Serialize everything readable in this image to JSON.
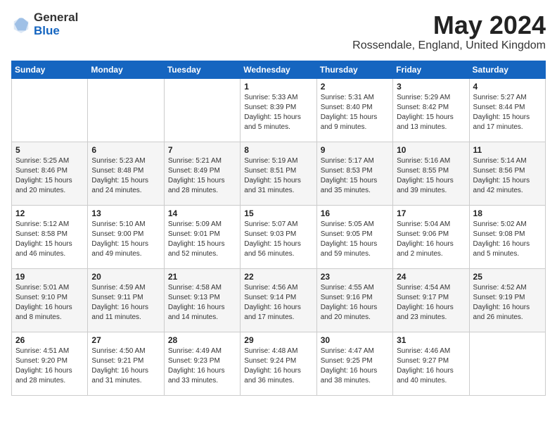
{
  "header": {
    "logo_general": "General",
    "logo_blue": "Blue",
    "month_year": "May 2024",
    "location": "Rossendale, England, United Kingdom"
  },
  "days_of_week": [
    "Sunday",
    "Monday",
    "Tuesday",
    "Wednesday",
    "Thursday",
    "Friday",
    "Saturday"
  ],
  "weeks": [
    [
      {
        "day": "",
        "info": ""
      },
      {
        "day": "",
        "info": ""
      },
      {
        "day": "",
        "info": ""
      },
      {
        "day": "1",
        "info": "Sunrise: 5:33 AM\nSunset: 8:39 PM\nDaylight: 15 hours\nand 5 minutes."
      },
      {
        "day": "2",
        "info": "Sunrise: 5:31 AM\nSunset: 8:40 PM\nDaylight: 15 hours\nand 9 minutes."
      },
      {
        "day": "3",
        "info": "Sunrise: 5:29 AM\nSunset: 8:42 PM\nDaylight: 15 hours\nand 13 minutes."
      },
      {
        "day": "4",
        "info": "Sunrise: 5:27 AM\nSunset: 8:44 PM\nDaylight: 15 hours\nand 17 minutes."
      }
    ],
    [
      {
        "day": "5",
        "info": "Sunrise: 5:25 AM\nSunset: 8:46 PM\nDaylight: 15 hours\nand 20 minutes."
      },
      {
        "day": "6",
        "info": "Sunrise: 5:23 AM\nSunset: 8:48 PM\nDaylight: 15 hours\nand 24 minutes."
      },
      {
        "day": "7",
        "info": "Sunrise: 5:21 AM\nSunset: 8:49 PM\nDaylight: 15 hours\nand 28 minutes."
      },
      {
        "day": "8",
        "info": "Sunrise: 5:19 AM\nSunset: 8:51 PM\nDaylight: 15 hours\nand 31 minutes."
      },
      {
        "day": "9",
        "info": "Sunrise: 5:17 AM\nSunset: 8:53 PM\nDaylight: 15 hours\nand 35 minutes."
      },
      {
        "day": "10",
        "info": "Sunrise: 5:16 AM\nSunset: 8:55 PM\nDaylight: 15 hours\nand 39 minutes."
      },
      {
        "day": "11",
        "info": "Sunrise: 5:14 AM\nSunset: 8:56 PM\nDaylight: 15 hours\nand 42 minutes."
      }
    ],
    [
      {
        "day": "12",
        "info": "Sunrise: 5:12 AM\nSunset: 8:58 PM\nDaylight: 15 hours\nand 46 minutes."
      },
      {
        "day": "13",
        "info": "Sunrise: 5:10 AM\nSunset: 9:00 PM\nDaylight: 15 hours\nand 49 minutes."
      },
      {
        "day": "14",
        "info": "Sunrise: 5:09 AM\nSunset: 9:01 PM\nDaylight: 15 hours\nand 52 minutes."
      },
      {
        "day": "15",
        "info": "Sunrise: 5:07 AM\nSunset: 9:03 PM\nDaylight: 15 hours\nand 56 minutes."
      },
      {
        "day": "16",
        "info": "Sunrise: 5:05 AM\nSunset: 9:05 PM\nDaylight: 15 hours\nand 59 minutes."
      },
      {
        "day": "17",
        "info": "Sunrise: 5:04 AM\nSunset: 9:06 PM\nDaylight: 16 hours\nand 2 minutes."
      },
      {
        "day": "18",
        "info": "Sunrise: 5:02 AM\nSunset: 9:08 PM\nDaylight: 16 hours\nand 5 minutes."
      }
    ],
    [
      {
        "day": "19",
        "info": "Sunrise: 5:01 AM\nSunset: 9:10 PM\nDaylight: 16 hours\nand 8 minutes."
      },
      {
        "day": "20",
        "info": "Sunrise: 4:59 AM\nSunset: 9:11 PM\nDaylight: 16 hours\nand 11 minutes."
      },
      {
        "day": "21",
        "info": "Sunrise: 4:58 AM\nSunset: 9:13 PM\nDaylight: 16 hours\nand 14 minutes."
      },
      {
        "day": "22",
        "info": "Sunrise: 4:56 AM\nSunset: 9:14 PM\nDaylight: 16 hours\nand 17 minutes."
      },
      {
        "day": "23",
        "info": "Sunrise: 4:55 AM\nSunset: 9:16 PM\nDaylight: 16 hours\nand 20 minutes."
      },
      {
        "day": "24",
        "info": "Sunrise: 4:54 AM\nSunset: 9:17 PM\nDaylight: 16 hours\nand 23 minutes."
      },
      {
        "day": "25",
        "info": "Sunrise: 4:52 AM\nSunset: 9:19 PM\nDaylight: 16 hours\nand 26 minutes."
      }
    ],
    [
      {
        "day": "26",
        "info": "Sunrise: 4:51 AM\nSunset: 9:20 PM\nDaylight: 16 hours\nand 28 minutes."
      },
      {
        "day": "27",
        "info": "Sunrise: 4:50 AM\nSunset: 9:21 PM\nDaylight: 16 hours\nand 31 minutes."
      },
      {
        "day": "28",
        "info": "Sunrise: 4:49 AM\nSunset: 9:23 PM\nDaylight: 16 hours\nand 33 minutes."
      },
      {
        "day": "29",
        "info": "Sunrise: 4:48 AM\nSunset: 9:24 PM\nDaylight: 16 hours\nand 36 minutes."
      },
      {
        "day": "30",
        "info": "Sunrise: 4:47 AM\nSunset: 9:25 PM\nDaylight: 16 hours\nand 38 minutes."
      },
      {
        "day": "31",
        "info": "Sunrise: 4:46 AM\nSunset: 9:27 PM\nDaylight: 16 hours\nand 40 minutes."
      },
      {
        "day": "",
        "info": ""
      }
    ]
  ]
}
